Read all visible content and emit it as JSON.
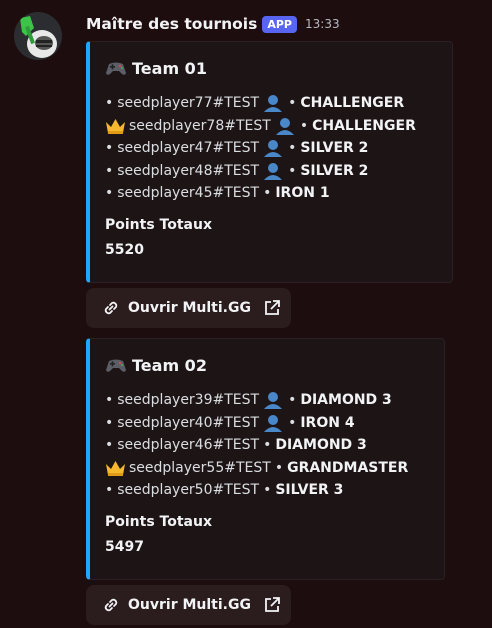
{
  "message": {
    "author": "Maître des tournois",
    "app_tag": "APP",
    "timestamp": "13:33"
  },
  "colors": {
    "embed_accent": "#1ea7fd",
    "app_tag": "#5865f2",
    "background": "#1e0d0e"
  },
  "embeds": [
    {
      "title": "Team 01",
      "title_icon": "gamepad-icon",
      "players": [
        {
          "bullet": "•",
          "name": "seedplayer77#TEST",
          "icon": "person-icon",
          "sep": "•",
          "rank": "CHALLENGER"
        },
        {
          "bullet": "",
          "name": "seedplayer78#TEST",
          "icon": "person-icon",
          "sep": "•",
          "rank": "CHALLENGER",
          "leader": "crown-icon"
        },
        {
          "bullet": "•",
          "name": "seedplayer47#TEST",
          "icon": "person-icon",
          "sep": "•",
          "rank": "SILVER 2"
        },
        {
          "bullet": "•",
          "name": "seedplayer48#TEST",
          "icon": "person-icon",
          "sep": "•",
          "rank": "SILVER 2"
        },
        {
          "bullet": "•",
          "name": "seedplayer45#TEST",
          "icon": "",
          "sep": "•",
          "rank": "IRON 1"
        }
      ],
      "field_name": "Points Totaux",
      "field_value": "5520",
      "button_label": "Ouvrir Multi.GG"
    },
    {
      "title": "Team 02",
      "title_icon": "gamepad-icon",
      "players": [
        {
          "bullet": "•",
          "name": "seedplayer39#TEST",
          "icon": "person-icon",
          "sep": "•",
          "rank": "DIAMOND 3"
        },
        {
          "bullet": "•",
          "name": "seedplayer40#TEST",
          "icon": "person-icon",
          "sep": "•",
          "rank": "IRON 4"
        },
        {
          "bullet": "•",
          "name": "seedplayer46#TEST",
          "icon": "",
          "sep": "•",
          "rank": "DIAMOND 3"
        },
        {
          "bullet": "",
          "name": "seedplayer55#TEST",
          "icon": "",
          "sep": "•",
          "rank": "GRANDMASTER",
          "leader": "crown-icon"
        },
        {
          "bullet": "•",
          "name": "seedplayer50#TEST",
          "icon": "",
          "sep": "•",
          "rank": "SILVER 3"
        }
      ],
      "field_name": "Points Totaux",
      "field_value": "5497",
      "button_label": "Ouvrir Multi.GG"
    }
  ]
}
